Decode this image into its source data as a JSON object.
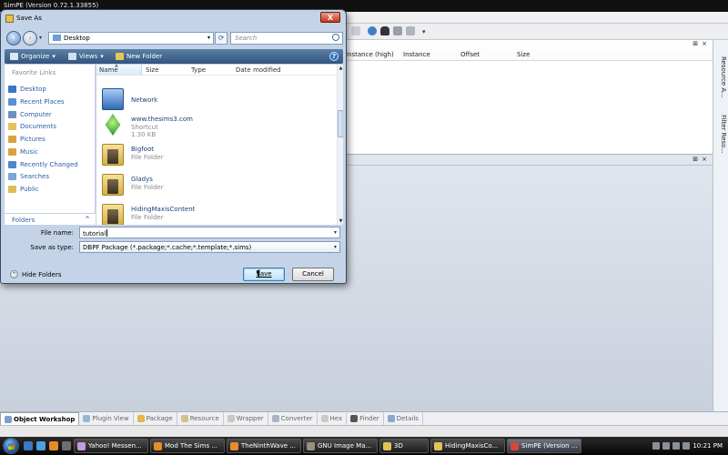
{
  "app": {
    "title": "SimPE (Version 0.72.1.33855)",
    "columns": [
      "Instance (high)",
      "Instance",
      "Offset",
      "Size"
    ],
    "side_tabs": [
      "Resource A...",
      "Filter Reso..."
    ],
    "plugin_tabs": [
      {
        "label": "Object Workshop",
        "icon": "workshop-icon",
        "active": true
      },
      {
        "label": "Plugin View",
        "icon": "plugin-icon",
        "active": false
      },
      {
        "label": "Package",
        "icon": "package-icon",
        "active": false
      },
      {
        "label": "Resource",
        "icon": "resource-icon",
        "active": false
      },
      {
        "label": "Wrapper",
        "icon": "wrapper-icon",
        "active": false
      },
      {
        "label": "Converter",
        "icon": "converter-icon",
        "active": false
      },
      {
        "label": "Hex",
        "icon": "hex-icon",
        "active": false
      },
      {
        "label": "Finder",
        "icon": "finder-icon",
        "active": false
      },
      {
        "label": "Details",
        "icon": "details-icon",
        "active": false
      }
    ]
  },
  "dialog": {
    "title": "Save As",
    "close_label": "X",
    "address": "Desktop",
    "search_placeholder": "Search",
    "commands": {
      "organize": "Organize",
      "views": "Views",
      "new_folder": "New Folder",
      "help": "?"
    },
    "favorite_links_heading": "Favorite Links",
    "favorite_links": [
      {
        "label": "Desktop",
        "icon": "desktop-icon",
        "color": "#3b78c9"
      },
      {
        "label": "Recent Places",
        "icon": "recent-places-icon",
        "color": "#5c8fd0"
      },
      {
        "label": "Computer",
        "icon": "computer-icon",
        "color": "#6e8fb8"
      },
      {
        "label": "Documents",
        "icon": "documents-icon",
        "color": "#e2c25a"
      },
      {
        "label": "Pictures",
        "icon": "pictures-icon",
        "color": "#d9a53a"
      },
      {
        "label": "Music",
        "icon": "music-icon",
        "color": "#d8a23c"
      },
      {
        "label": "Recently Changed",
        "icon": "recently-changed-icon",
        "color": "#4f86c6"
      },
      {
        "label": "Searches",
        "icon": "searches-icon",
        "color": "#7aa6d8"
      },
      {
        "label": "Public",
        "icon": "public-icon",
        "color": "#e0bc54"
      }
    ],
    "folders_label": "Folders",
    "file_columns": [
      "Name",
      "Size",
      "Type",
      "Date modified"
    ],
    "files": [
      {
        "name": "Network",
        "type": "",
        "size": "",
        "icon": "network-icon"
      },
      {
        "name": "www.thesims3.com",
        "type": "Shortcut",
        "size": "1.30 KB",
        "icon": "sims-shortcut-icon"
      },
      {
        "name": "Bigfoot",
        "type": "File Folder",
        "size": "",
        "icon": "folder-icon"
      },
      {
        "name": "Gladys",
        "type": "File Folder",
        "size": "",
        "icon": "folder-icon"
      },
      {
        "name": "HidingMaxisContent",
        "type": "File Folder",
        "size": "",
        "icon": "folder-icon"
      }
    ],
    "file_name_label": "File name:",
    "file_name_value": "tutorial",
    "save_type_label": "Save as type:",
    "save_type_value": "DBPF Package (*.package;*.cache;*.template;*.sims)",
    "hide_folders_label": "Hide Folders",
    "save_label": "Save",
    "cancel_label": "Cancel"
  },
  "taskbar": {
    "tasks": [
      {
        "label": "Yahoo! Messen...",
        "color": "#c89bd8",
        "active": false
      },
      {
        "label": "Mod The Sims ...",
        "color": "#e58b2b",
        "active": false
      },
      {
        "label": "TheNinthWave ...",
        "color": "#e58b2b",
        "active": false
      },
      {
        "label": "GNU Image Ma...",
        "color": "#9a8e7c",
        "active": false
      },
      {
        "label": "3D",
        "color": "#e3c25a",
        "active": false,
        "small": true
      },
      {
        "label": "HidingMaxisCo...",
        "color": "#e3c25a",
        "active": false
      },
      {
        "label": "SimPE (Version ...",
        "color": "#d24a3a",
        "active": true
      }
    ],
    "clock": "10:21 PM"
  }
}
